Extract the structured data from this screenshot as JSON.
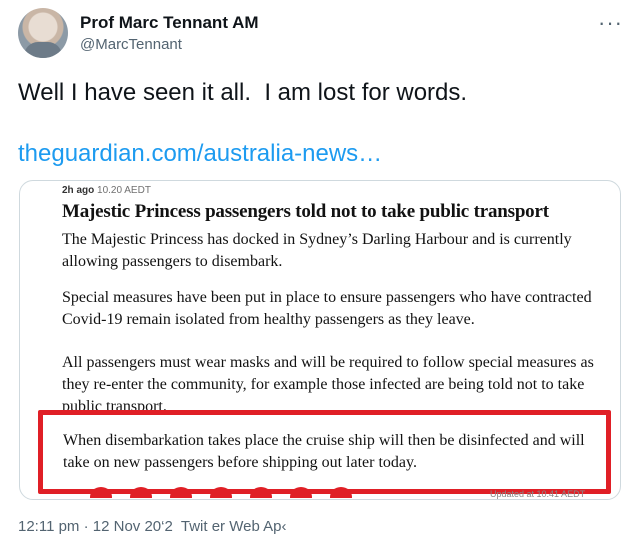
{
  "author": {
    "name": "Prof Marc Tennant AM",
    "handle": "@MarcTennant"
  },
  "more_icon": "more-horizontal-icon",
  "tweet": {
    "text": "Well I have seen it all.  I am lost for words.",
    "link_text": "theguardian.com/australia-news…"
  },
  "card": {
    "meta_time": "2h ago",
    "meta_clock": "10.20 AEDT",
    "headline": "Majestic Princess passengers told not to take public transport",
    "paragraphs": [
      "The Majestic Princess has docked in Sydney’s Darling Harbour and is currently allowing passengers to disembark.",
      "Special measures have been put in place to ensure passengers who have contracted Covid-19 remain isolated from healthy passengers as they leave.",
      "All passengers must wear masks and will be required to follow special measures as they re-enter the community, for example those infected are being told not to take public transport."
    ],
    "highlighted": "When disembarkation takes place the cruise ship will then be disinfected and will take on new passengers before shipping out later today.",
    "updated": "Updated at 10.41 AEDT",
    "highlight_color": "#e01f26"
  },
  "footer": {
    "timestamp": "12:11 pm · 12 Nov 20‘2  Twit er Web Ap‹"
  },
  "colors": {
    "link": "#1d9bf0",
    "secondary_text": "#536471"
  }
}
